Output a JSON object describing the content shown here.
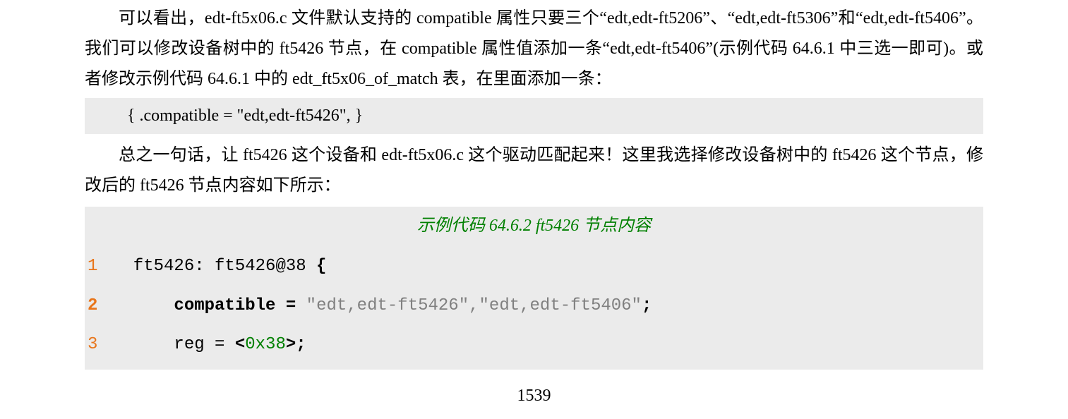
{
  "para1_part1": "可以看出，edt-ft5x06.c 文件默认支持的 compatible 属性只要三个“edt,edt-ft5206”、“edt,edt-ft5306”和“edt,edt-ft5406”。我们可以修改设备树中的 ft5426 节点，在 compatible 属性值添加一条“edt,edt-ft5406”(示例代码 64.6.1 中三选一即可)。或者修改示例代码 64.6.1 中的 edt_ft5x06_of_match 表，在里面添加一条：",
  "inline_code": "{ .compatible = \"edt,edt-ft5426\", }",
  "para2": "总之一句话，让 ft5426 这个设备和 edt-ft5x06.c 这个驱动匹配起来！这里我选择修改设备树中的 ft5426 这个节点，修改后的 ft5426 节点内容如下所示：",
  "code_caption": "示例代码 64.6.2 ft5426 节点内容",
  "code": {
    "line1": {
      "no": "1",
      "text_a": "  ft5426: ft5426@38 ",
      "brace": "{"
    },
    "line2": {
      "no": "2",
      "indent": "      ",
      "kw": "compatible",
      "eq": " = ",
      "str": "\"edt,edt-ft5426\",\"edt,edt-ft5406\"",
      "semi": ";"
    },
    "line3": {
      "no": "3",
      "indent": "      reg = ",
      "lt": "<",
      "num": "0x38",
      "gt": ">;"
    }
  },
  "page_number": "1539"
}
